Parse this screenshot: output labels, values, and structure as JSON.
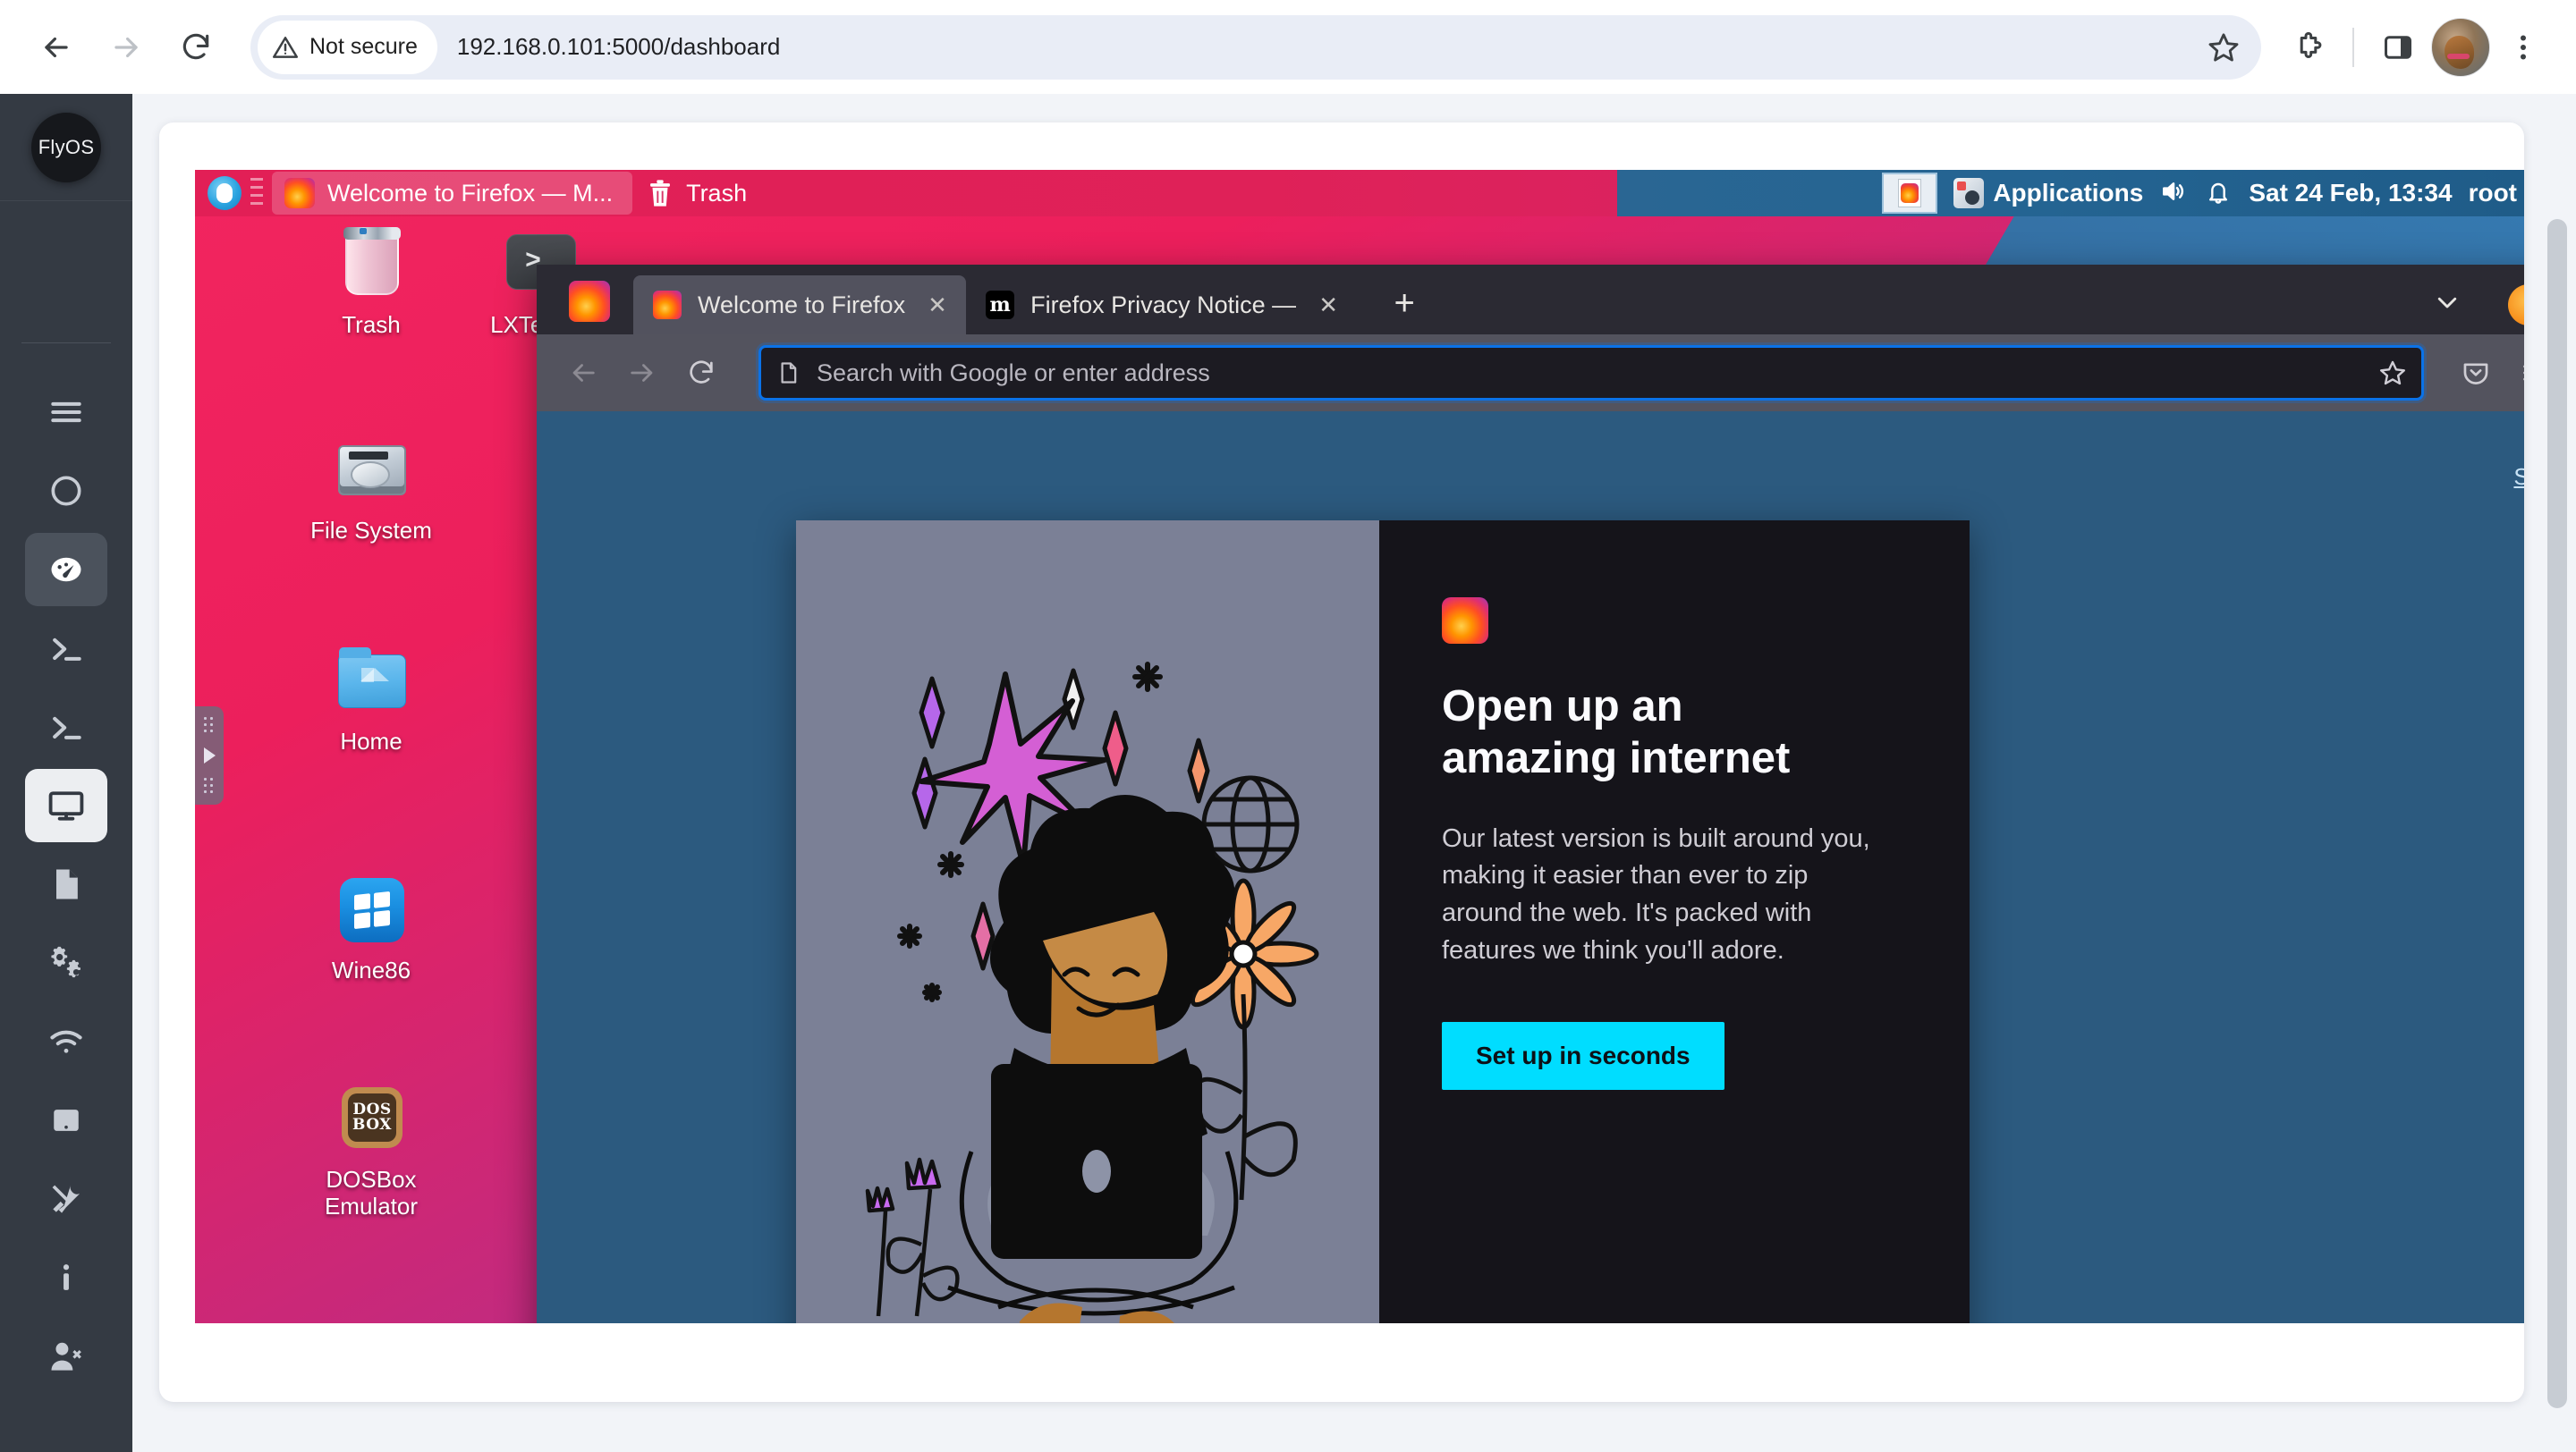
{
  "browser": {
    "back_icon": "arrow-left-icon",
    "forward_icon": "arrow-right-icon",
    "reload_icon": "reload-icon",
    "security_label": "Not secure",
    "security_icon": "warning-triangle-icon",
    "url": "192.168.0.101:5000/dashboard",
    "bookmark_icon": "star-icon",
    "extensions_icon": "puzzle-piece-icon",
    "side_panel_icon": "side-panel-icon",
    "profile_icon": "avatar",
    "menu_icon": "three-dot-menu-icon"
  },
  "sidebar": {
    "brand": "FlyOS",
    "items": [
      {
        "name": "menu",
        "icon": "hamburger-icon",
        "state": "normal"
      },
      {
        "name": "circle",
        "icon": "circle-icon",
        "state": "normal"
      },
      {
        "name": "dashboard",
        "icon": "gauge-icon",
        "state": "active-dim"
      },
      {
        "name": "terminal-1",
        "icon": "terminal-icon",
        "state": "normal"
      },
      {
        "name": "terminal-2",
        "icon": "terminal-icon",
        "state": "normal"
      },
      {
        "name": "display",
        "icon": "monitor-icon",
        "state": "active-light"
      },
      {
        "name": "files",
        "icon": "file-icon",
        "state": "normal"
      },
      {
        "name": "settings",
        "icon": "gears-icon",
        "state": "normal"
      },
      {
        "name": "network",
        "icon": "wifi-icon",
        "state": "normal"
      },
      {
        "name": "device",
        "icon": "tablet-icon",
        "state": "normal"
      },
      {
        "name": "tools",
        "icon": "tools-icon",
        "state": "normal"
      },
      {
        "name": "info",
        "icon": "info-icon",
        "state": "normal"
      },
      {
        "name": "logout",
        "icon": "user-remove-icon",
        "state": "normal"
      }
    ]
  },
  "vnc": {
    "handle_icon": "drag-handle-play-icon",
    "panel": {
      "mouse_icon": "mouse-cursor-icon",
      "grip_icon": "panel-grip-icon",
      "tasks": [
        {
          "label": "Welcome to Firefox — M...",
          "icon": "firefox-icon",
          "active": true
        },
        {
          "label": "Trash",
          "icon": "trash-icon",
          "active": false
        }
      ],
      "window_thumb_icon": "firefox-window-icon",
      "applications_label": "Applications",
      "applications_icon": "applications-menu-icon",
      "volume_icon": "speaker-icon",
      "notification_icon": "bell-icon",
      "clock": "Sat 24 Feb, 13:34",
      "user": "root"
    },
    "desktop_icons": [
      {
        "label": "Trash",
        "icon": "trash-icon"
      },
      {
        "label": "LXTermin",
        "icon": "terminal-icon"
      },
      {
        "label": "File System",
        "icon": "hard-disk-icon"
      },
      {
        "label": "Home",
        "icon": "home-folder-icon"
      },
      {
        "label": "Wine86",
        "icon": "windows-icon"
      },
      {
        "label": "DOSBox\nEmulator",
        "icon": "dosbox-icon",
        "dos_top": "DOS",
        "dos_bottom": "BOX"
      }
    ]
  },
  "firefox": {
    "app_icon": "firefox-icon",
    "tabs": [
      {
        "title": "Welcome to Firefox",
        "favicon": "firefox-icon",
        "active": true,
        "close_icon": "close-icon"
      },
      {
        "title": "Firefox Privacy Notice —",
        "favicon": "mozilla-icon",
        "active": false,
        "close_icon": "close-icon"
      }
    ],
    "new_tab_icon": "plus-icon",
    "list_all_tabs_icon": "chevron-down-icon",
    "account_icon": "account-circle-icon",
    "nav": {
      "back_icon": "arrow-left-icon",
      "forward_icon": "arrow-right-icon",
      "reload_icon": "reload-icon",
      "page_icon": "page-icon",
      "placeholder": "Search with Google or enter address",
      "bookmark_icon": "star-icon",
      "pocket_icon": "pocket-icon",
      "menu_icon": "hamburger-icon"
    },
    "content": {
      "signin_label": "Sig",
      "logo_icon": "firefox-icon",
      "heading": "Open up an amazing internet",
      "body": "Our latest version is built around you, making it easier than ever to zip around the web. It's packed with features we think you'll adore.",
      "cta_label": "Set up in seconds",
      "illustration": "person-with-laptop-illustration"
    }
  },
  "colors": {
    "sidebar_bg": "#343a43",
    "accent_blue": "#0b72e7",
    "firefox_chrome": "#2b2a33",
    "cta_cyan": "#00ddff",
    "desktop_pink": "#f2255f",
    "desktop_purple": "#7b3fad",
    "panel_blue": "#2a6693"
  }
}
